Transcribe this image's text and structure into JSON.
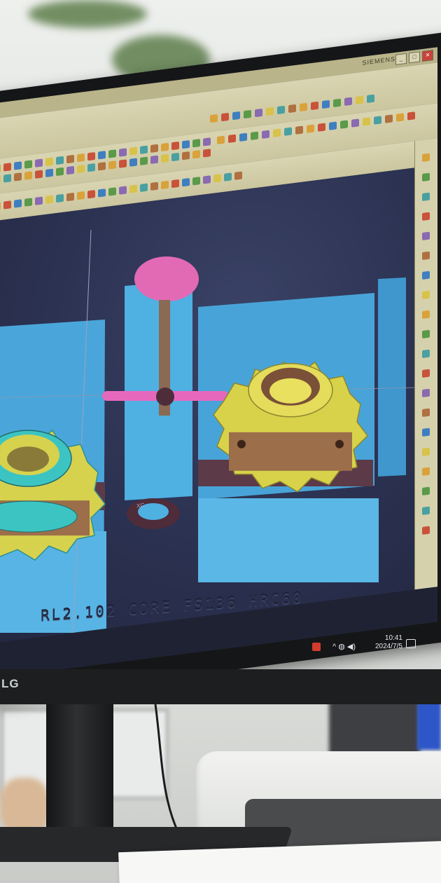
{
  "app": {
    "vendor": "SIEMENS",
    "window_buttons": [
      "_",
      "□",
      "✕"
    ]
  },
  "viewport": {
    "engraving": "RL2.102 CORE FS136 HRC60",
    "axis_label": "XC"
  },
  "taskbar": {
    "time": "10:41",
    "date": "2024/7/5"
  },
  "monitor": {
    "brand": "LG"
  },
  "icons": [
    "siemens-nx-app-icon",
    "tray-chevron-icon",
    "network-icon",
    "volume-icon",
    "notification-icon"
  ],
  "colors": {
    "gear_yellow": "#d8d24a",
    "gear_bronze": "#9c6e4a",
    "gear_cyan": "#38c0c0",
    "mold_blue": "#4aa8dc",
    "sprue_pink": "#e060b0",
    "viewport_bg": "#2b3150",
    "toolbar_bg": "#d2cda8"
  }
}
